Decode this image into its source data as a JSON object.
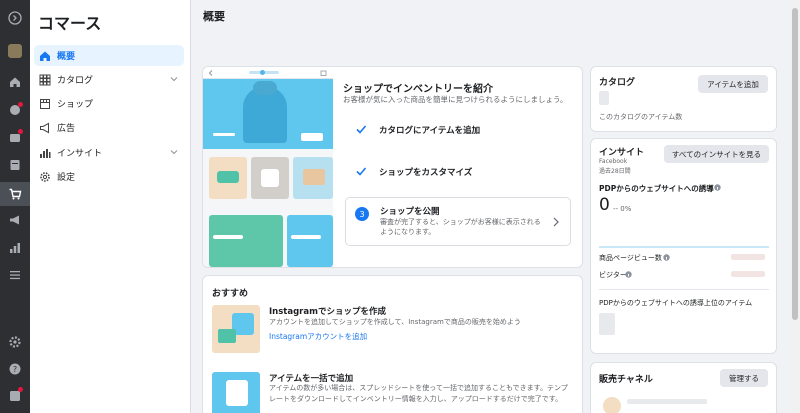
{
  "sidebar": {
    "app_title": "コマース",
    "items": [
      {
        "label": "概要",
        "icon": "home-icon"
      },
      {
        "label": "カタログ",
        "icon": "grid-icon"
      },
      {
        "label": "ショップ",
        "icon": "shop-icon"
      },
      {
        "label": "広告",
        "icon": "megaphone-icon"
      },
      {
        "label": "インサイト",
        "icon": "bar-chart-icon"
      },
      {
        "label": "設定",
        "icon": "gear-icon"
      }
    ]
  },
  "page_title": "概要",
  "setup": {
    "title": "ショップでインベントリーを紹介",
    "subtitle": "お客様が気に入った商品を簡単に見つけられるようにしましょう。",
    "steps": [
      {
        "label": "カタログにアイテムを追加",
        "status": "done"
      },
      {
        "label": "ショップをカスタマイズ",
        "status": "done"
      }
    ],
    "current_step": {
      "number": "3",
      "label": "ショップを公開",
      "desc": "審査が完了すると、ショップがお客様に表示されるようになります。"
    }
  },
  "recommend": {
    "title": "おすすめ",
    "items": [
      {
        "title": "Instagramでショップを作成",
        "desc": "アカウントを追加してショップを作成して、Instagramで商品の販売を始めよう",
        "link": "Instagramアカウントを追加"
      },
      {
        "title": "アイテムを一括で追加",
        "desc": "アイテムの数が多い場合は、スプレッドシートを使って一括で追加することもできます。テンプレートをダウンロードしてインベントリー情報を入力し、アップロードするだけで完了です。"
      }
    ]
  },
  "catalog_card": {
    "title": "カタログ",
    "button": "アイテムを追加",
    "caption": "このカタログのアイテム数"
  },
  "insights_card": {
    "title": "インサイト",
    "source": "Facebook",
    "period": "過去28日間",
    "button": "すべてのインサイトを見る",
    "metric_label": "PDPからのウェブサイトへの誘導",
    "metric_value": "0",
    "metric_delta": "-- 0%",
    "rows": [
      "商品ページビュー数",
      "ビジター"
    ],
    "top_items_label": "PDPからのウェブサイトへの誘導上位のアイテム"
  },
  "channels_card": {
    "title": "販売チャネル",
    "button": "管理する"
  },
  "colors": {
    "accent": "#1877f2",
    "rail": "#2d2f33",
    "active_bg": "#e7f3ff"
  }
}
